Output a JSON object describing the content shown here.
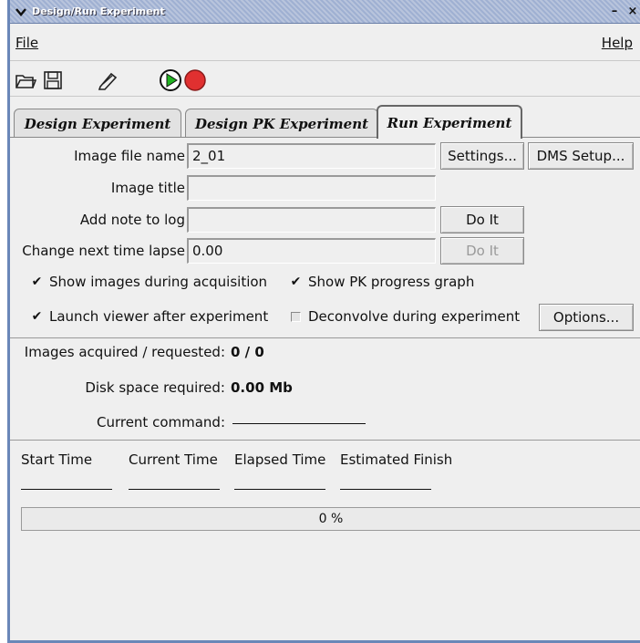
{
  "window": {
    "title": "Design/Run Experiment"
  },
  "titlebar_buttons": {
    "minimize": "–",
    "close": "×"
  },
  "menu": {
    "file": "File",
    "help": "Help"
  },
  "toolbar": [
    "open-icon",
    "save-icon",
    "edit-icon",
    "play-icon",
    "stop-icon"
  ],
  "tabs": [
    {
      "label": "Design Experiment",
      "active": false
    },
    {
      "label": "Design PK Experiment",
      "active": false
    },
    {
      "label": "Run Experiment",
      "active": true
    }
  ],
  "form": {
    "image_file_name_label": "Image file name",
    "image_file_name_value": "2_01",
    "settings_button": "Settings...",
    "dms_setup_button": "DMS Setup...",
    "image_title_label": "Image title",
    "image_title_value": "",
    "add_note_label": "Add note to log",
    "add_note_value": "",
    "do_it_button": "Do It",
    "change_lapse_label": "Change next time lapse",
    "change_lapse_value": "0.00",
    "do_it_button_2": "Do It"
  },
  "checkboxes": {
    "show_images": {
      "label": "Show images during acquisition",
      "checked": true
    },
    "show_pk": {
      "label": "Show PK progress graph",
      "checked": true
    },
    "launch_viewer": {
      "label": "Launch viewer after experiment",
      "checked": true
    },
    "deconvolve": {
      "label": "Deconvolve during experiment",
      "checked": false
    },
    "options_button": "Options..."
  },
  "status": {
    "images_label": "Images acquired / requested:",
    "images_value": "0 / 0",
    "disk_label": "Disk space required:",
    "disk_value": "0.00 Mb",
    "command_label": "Current command:"
  },
  "times": {
    "start": "Start Time",
    "current": "Current Time",
    "elapsed": "Elapsed Time",
    "finish": "Estimated Finish"
  },
  "progress": {
    "percent": 0,
    "text": "0 %"
  },
  "colors": {
    "accent": "#6a87b8",
    "play": "#22b422",
    "stop": "#e03030"
  }
}
